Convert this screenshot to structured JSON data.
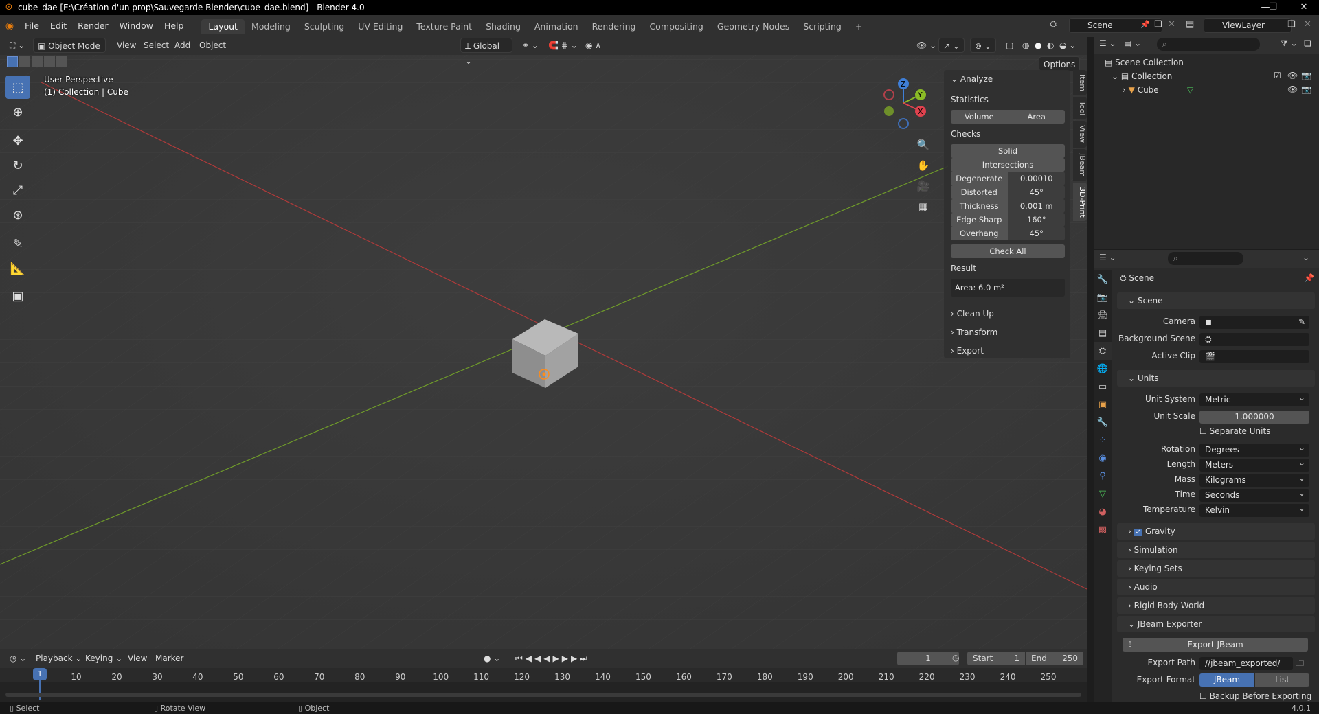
{
  "titlebar": {
    "title": "cube_dae [E:\\Création d'un prop\\Sauvegarde Blender\\cube_dae.blend] - Blender 4.0"
  },
  "menu": {
    "items": [
      "File",
      "Edit",
      "Render",
      "Window",
      "Help"
    ]
  },
  "workspaces": [
    "Layout",
    "Modeling",
    "Sculpting",
    "UV Editing",
    "Texture Paint",
    "Shading",
    "Animation",
    "Rendering",
    "Compositing",
    "Geometry Nodes",
    "Scripting"
  ],
  "scene_field": "Scene",
  "viewlayer_field": "ViewLayer",
  "viewport_header": {
    "mode": "Object Mode",
    "menus": [
      "View",
      "Select",
      "Add",
      "Object"
    ],
    "orientation": "Global",
    "options": "Options"
  },
  "viewport": {
    "perspective": "User Perspective",
    "collection": "(1) Collection | Cube"
  },
  "gizmo": {
    "z": "Z",
    "y": "Y",
    "x": "X"
  },
  "npanel": {
    "tabs": [
      "Item",
      "Tool",
      "View",
      "JBeam",
      "3D-Print"
    ],
    "analyze": "Analyze",
    "statistics": "Statistics",
    "volume": "Volume",
    "area": "Area",
    "checks": "Checks",
    "solid": "Solid",
    "intersections": "Intersections",
    "rows": [
      {
        "label": "Degenerate",
        "value": "0.00010"
      },
      {
        "label": "Distorted",
        "value": "45°"
      },
      {
        "label": "Thickness",
        "value": "0.001 m"
      },
      {
        "label": "Edge Sharp",
        "value": "160°"
      },
      {
        "label": "Overhang",
        "value": "45°"
      }
    ],
    "check_all": "Check All",
    "result": "Result",
    "result_value": "Area: 6.0 m²",
    "cleanup": "Clean Up",
    "transform": "Transform",
    "export": "Export"
  },
  "outliner": {
    "scene_collection": "Scene Collection",
    "collection": "Collection",
    "cube": "Cube"
  },
  "properties": {
    "scene_title": "Scene",
    "sec_scene": "Scene",
    "camera": "Camera",
    "background_scene": "Background Scene",
    "active_clip": "Active Clip",
    "sec_units": "Units",
    "unit_system": "Unit System",
    "unit_system_val": "Metric",
    "unit_scale": "Unit Scale",
    "unit_scale_val": "1.000000",
    "separate_units": "Separate Units",
    "rotation": "Rotation",
    "rotation_val": "Degrees",
    "length": "Length",
    "length_val": "Meters",
    "mass": "Mass",
    "mass_val": "Kilograms",
    "time": "Time",
    "time_val": "Seconds",
    "temperature": "Temperature",
    "temperature_val": "Kelvin",
    "gravity": "Gravity",
    "simulation": "Simulation",
    "keying_sets": "Keying Sets",
    "audio": "Audio",
    "rigid_body_world": "Rigid Body World",
    "jbeam_exporter": "JBeam Exporter",
    "export_jbeam": "Export JBeam",
    "export_path": "Export Path",
    "export_path_val": "//jbeam_exported/",
    "export_format": "Export Format",
    "fmt_jbeam": "JBeam",
    "fmt_list": "List",
    "backup": "Backup Before Exporting"
  },
  "timeline": {
    "menus": [
      "Playback",
      "Keying",
      "View",
      "Marker"
    ],
    "current_frame": "1",
    "start_label": "Start",
    "start": "1",
    "end_label": "End",
    "end": "250",
    "ticks": [
      "1",
      "10",
      "20",
      "30",
      "40",
      "50",
      "60",
      "70",
      "80",
      "90",
      "100",
      "110",
      "120",
      "130",
      "140",
      "150",
      "160",
      "170",
      "180",
      "190",
      "200",
      "210",
      "220",
      "230",
      "240",
      "250"
    ]
  },
  "statusbar": {
    "select": "Select",
    "rotate": "Rotate View",
    "object": "Object",
    "version": "4.0.1"
  }
}
